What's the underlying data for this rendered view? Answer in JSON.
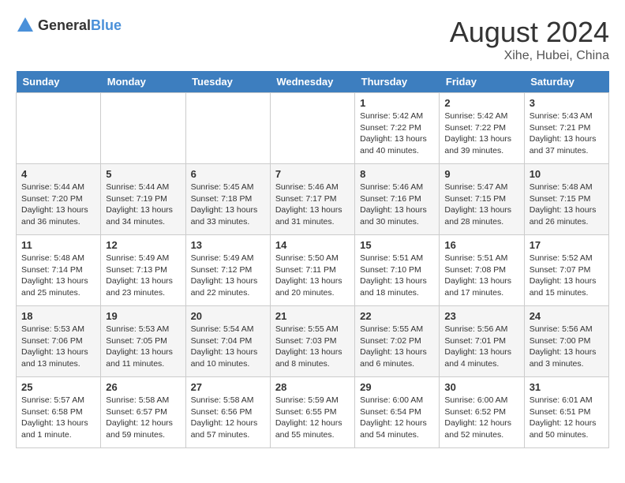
{
  "header": {
    "logo_general": "General",
    "logo_blue": "Blue",
    "month_year": "August 2024",
    "location": "Xihe, Hubei, China"
  },
  "weekdays": [
    "Sunday",
    "Monday",
    "Tuesday",
    "Wednesday",
    "Thursday",
    "Friday",
    "Saturday"
  ],
  "weeks": [
    [
      {
        "day": "",
        "sunrise": "",
        "sunset": "",
        "daylight": ""
      },
      {
        "day": "",
        "sunrise": "",
        "sunset": "",
        "daylight": ""
      },
      {
        "day": "",
        "sunrise": "",
        "sunset": "",
        "daylight": ""
      },
      {
        "day": "",
        "sunrise": "",
        "sunset": "",
        "daylight": ""
      },
      {
        "day": "1",
        "sunrise": "Sunrise: 5:42 AM",
        "sunset": "Sunset: 7:22 PM",
        "daylight": "Daylight: 13 hours and 40 minutes."
      },
      {
        "day": "2",
        "sunrise": "Sunrise: 5:42 AM",
        "sunset": "Sunset: 7:22 PM",
        "daylight": "Daylight: 13 hours and 39 minutes."
      },
      {
        "day": "3",
        "sunrise": "Sunrise: 5:43 AM",
        "sunset": "Sunset: 7:21 PM",
        "daylight": "Daylight: 13 hours and 37 minutes."
      }
    ],
    [
      {
        "day": "4",
        "sunrise": "Sunrise: 5:44 AM",
        "sunset": "Sunset: 7:20 PM",
        "daylight": "Daylight: 13 hours and 36 minutes."
      },
      {
        "day": "5",
        "sunrise": "Sunrise: 5:44 AM",
        "sunset": "Sunset: 7:19 PM",
        "daylight": "Daylight: 13 hours and 34 minutes."
      },
      {
        "day": "6",
        "sunrise": "Sunrise: 5:45 AM",
        "sunset": "Sunset: 7:18 PM",
        "daylight": "Daylight: 13 hours and 33 minutes."
      },
      {
        "day": "7",
        "sunrise": "Sunrise: 5:46 AM",
        "sunset": "Sunset: 7:17 PM",
        "daylight": "Daylight: 13 hours and 31 minutes."
      },
      {
        "day": "8",
        "sunrise": "Sunrise: 5:46 AM",
        "sunset": "Sunset: 7:16 PM",
        "daylight": "Daylight: 13 hours and 30 minutes."
      },
      {
        "day": "9",
        "sunrise": "Sunrise: 5:47 AM",
        "sunset": "Sunset: 7:15 PM",
        "daylight": "Daylight: 13 hours and 28 minutes."
      },
      {
        "day": "10",
        "sunrise": "Sunrise: 5:48 AM",
        "sunset": "Sunset: 7:15 PM",
        "daylight": "Daylight: 13 hours and 26 minutes."
      }
    ],
    [
      {
        "day": "11",
        "sunrise": "Sunrise: 5:48 AM",
        "sunset": "Sunset: 7:14 PM",
        "daylight": "Daylight: 13 hours and 25 minutes."
      },
      {
        "day": "12",
        "sunrise": "Sunrise: 5:49 AM",
        "sunset": "Sunset: 7:13 PM",
        "daylight": "Daylight: 13 hours and 23 minutes."
      },
      {
        "day": "13",
        "sunrise": "Sunrise: 5:49 AM",
        "sunset": "Sunset: 7:12 PM",
        "daylight": "Daylight: 13 hours and 22 minutes."
      },
      {
        "day": "14",
        "sunrise": "Sunrise: 5:50 AM",
        "sunset": "Sunset: 7:11 PM",
        "daylight": "Daylight: 13 hours and 20 minutes."
      },
      {
        "day": "15",
        "sunrise": "Sunrise: 5:51 AM",
        "sunset": "Sunset: 7:10 PM",
        "daylight": "Daylight: 13 hours and 18 minutes."
      },
      {
        "day": "16",
        "sunrise": "Sunrise: 5:51 AM",
        "sunset": "Sunset: 7:08 PM",
        "daylight": "Daylight: 13 hours and 17 minutes."
      },
      {
        "day": "17",
        "sunrise": "Sunrise: 5:52 AM",
        "sunset": "Sunset: 7:07 PM",
        "daylight": "Daylight: 13 hours and 15 minutes."
      }
    ],
    [
      {
        "day": "18",
        "sunrise": "Sunrise: 5:53 AM",
        "sunset": "Sunset: 7:06 PM",
        "daylight": "Daylight: 13 hours and 13 minutes."
      },
      {
        "day": "19",
        "sunrise": "Sunrise: 5:53 AM",
        "sunset": "Sunset: 7:05 PM",
        "daylight": "Daylight: 13 hours and 11 minutes."
      },
      {
        "day": "20",
        "sunrise": "Sunrise: 5:54 AM",
        "sunset": "Sunset: 7:04 PM",
        "daylight": "Daylight: 13 hours and 10 minutes."
      },
      {
        "day": "21",
        "sunrise": "Sunrise: 5:55 AM",
        "sunset": "Sunset: 7:03 PM",
        "daylight": "Daylight: 13 hours and 8 minutes."
      },
      {
        "day": "22",
        "sunrise": "Sunrise: 5:55 AM",
        "sunset": "Sunset: 7:02 PM",
        "daylight": "Daylight: 13 hours and 6 minutes."
      },
      {
        "day": "23",
        "sunrise": "Sunrise: 5:56 AM",
        "sunset": "Sunset: 7:01 PM",
        "daylight": "Daylight: 13 hours and 4 minutes."
      },
      {
        "day": "24",
        "sunrise": "Sunrise: 5:56 AM",
        "sunset": "Sunset: 7:00 PM",
        "daylight": "Daylight: 13 hours and 3 minutes."
      }
    ],
    [
      {
        "day": "25",
        "sunrise": "Sunrise: 5:57 AM",
        "sunset": "Sunset: 6:58 PM",
        "daylight": "Daylight: 13 hours and 1 minute."
      },
      {
        "day": "26",
        "sunrise": "Sunrise: 5:58 AM",
        "sunset": "Sunset: 6:57 PM",
        "daylight": "Daylight: 12 hours and 59 minutes."
      },
      {
        "day": "27",
        "sunrise": "Sunrise: 5:58 AM",
        "sunset": "Sunset: 6:56 PM",
        "daylight": "Daylight: 12 hours and 57 minutes."
      },
      {
        "day": "28",
        "sunrise": "Sunrise: 5:59 AM",
        "sunset": "Sunset: 6:55 PM",
        "daylight": "Daylight: 12 hours and 55 minutes."
      },
      {
        "day": "29",
        "sunrise": "Sunrise: 6:00 AM",
        "sunset": "Sunset: 6:54 PM",
        "daylight": "Daylight: 12 hours and 54 minutes."
      },
      {
        "day": "30",
        "sunrise": "Sunrise: 6:00 AM",
        "sunset": "Sunset: 6:52 PM",
        "daylight": "Daylight: 12 hours and 52 minutes."
      },
      {
        "day": "31",
        "sunrise": "Sunrise: 6:01 AM",
        "sunset": "Sunset: 6:51 PM",
        "daylight": "Daylight: 12 hours and 50 minutes."
      }
    ]
  ]
}
